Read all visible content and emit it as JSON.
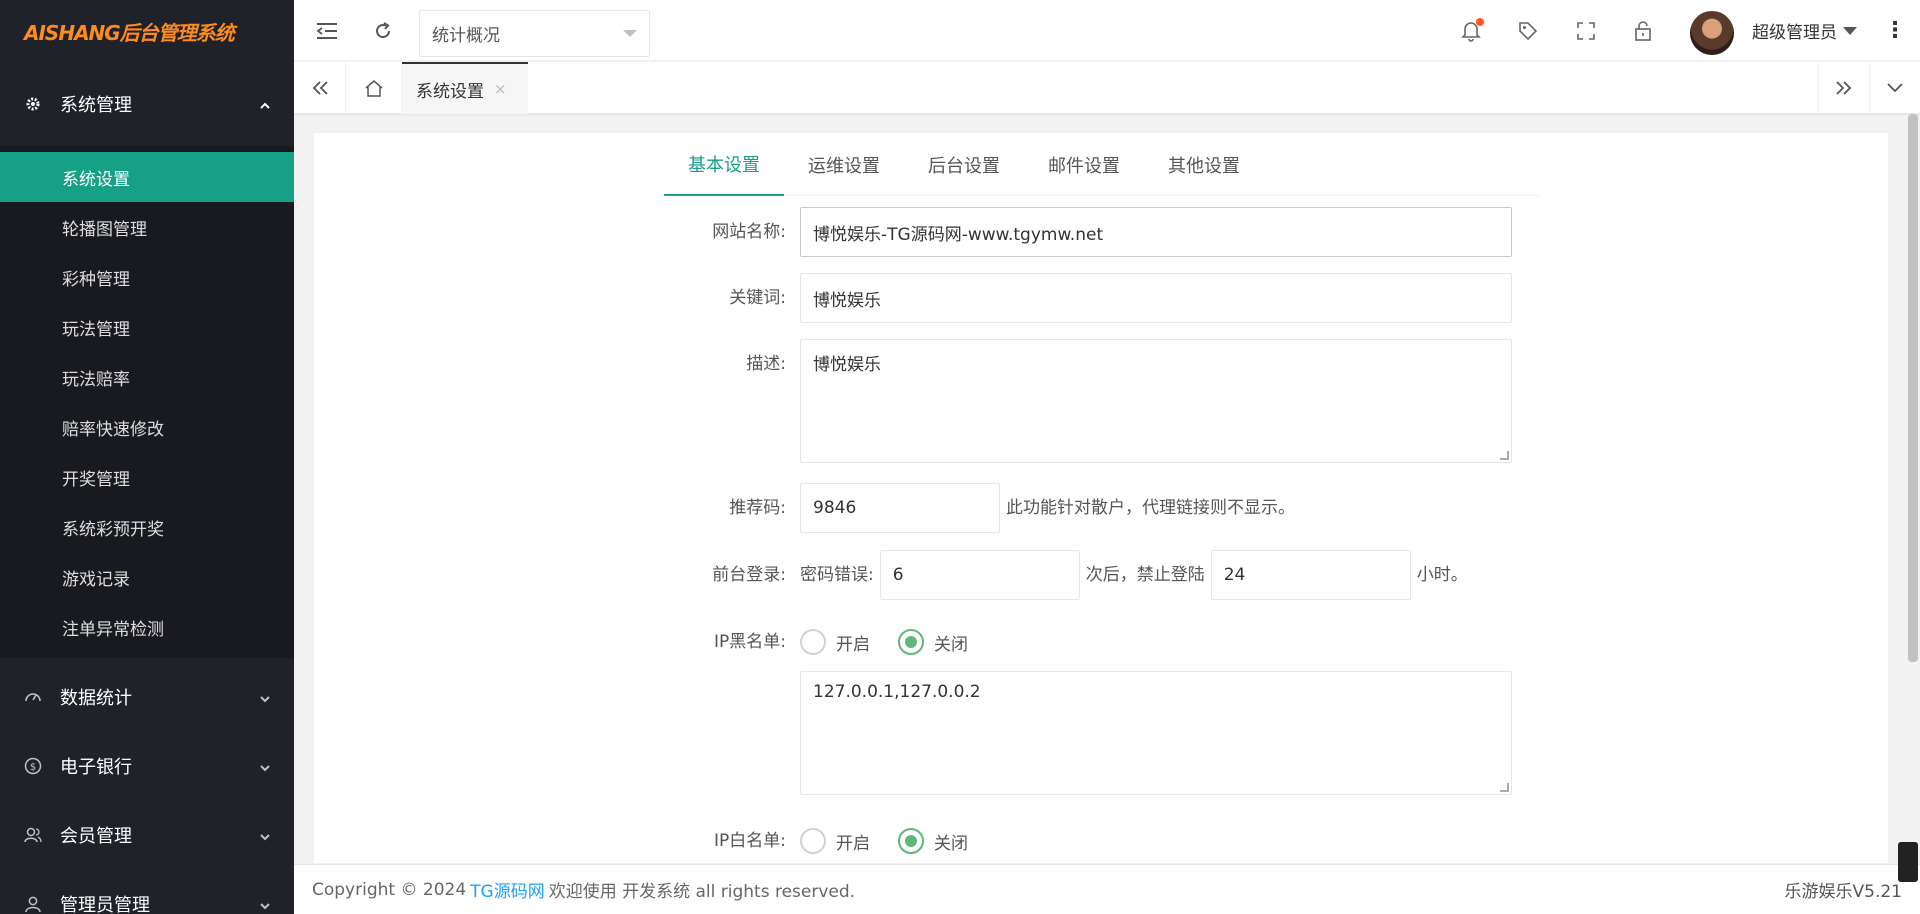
{
  "logo": "AISHANG后台管理系统",
  "sidebar": {
    "groups": [
      {
        "label": "系统管理",
        "icon": "gear-icon",
        "expanded": true
      },
      {
        "label": "数据统计",
        "icon": "dashboard-icon",
        "expanded": false
      },
      {
        "label": "电子银行",
        "icon": "dollar-icon",
        "expanded": false
      },
      {
        "label": "会员管理",
        "icon": "users-icon",
        "expanded": false
      },
      {
        "label": "管理员管理",
        "icon": "user-icon",
        "expanded": false
      }
    ],
    "system_items": [
      "系统设置",
      "轮播图管理",
      "彩种管理",
      "玩法管理",
      "玩法赔率",
      "赔率快速修改",
      "开奖管理",
      "系统彩预开奖",
      "游戏记录",
      "注单异常检测"
    ]
  },
  "header": {
    "select_value": "统计概况",
    "username": "超级管理员",
    "more": "⋮"
  },
  "tabsbar": {
    "active_tab": "系统设置",
    "close": "×"
  },
  "content": {
    "tabs": [
      "基本设置",
      "运维设置",
      "后台设置",
      "邮件设置",
      "其他设置"
    ],
    "site_name_label": "网站名称:",
    "site_name_value": "博悦娱乐-TG源码网-www.tgymw.net",
    "keywords_label": "关键词:",
    "keywords_value": "博悦娱乐",
    "desc_label": "描述:",
    "desc_value": "博悦娱乐",
    "ref_label": "推荐码:",
    "ref_value": "9846",
    "ref_note": "此功能针对散户，代理链接则不显示。",
    "login_label": "前台登录:",
    "login_pwd_label": "密码错误:",
    "login_pwd_value": "6",
    "login_mid": "次后，禁止登陆",
    "login_hours_value": "24",
    "login_hours_unit": "小时。",
    "ip_black_label": "IP黑名单:",
    "ip_black_value": "127.0.0.1,127.0.0.2",
    "ip_white_label": "IP白名单:",
    "radio_on": "开启",
    "radio_off": "关闭"
  },
  "footer": {
    "prefix": "Copyright © 2024",
    "link": "TG源码网",
    "suffix": "欢迎使用 开发系统 all rights reserved.",
    "version": "乐游娱乐V5.21"
  },
  "colors": {
    "sidebar_bg": "#20222a",
    "active_item": "#16a085",
    "radio_checked": "#5fb878",
    "link": "#1e9fff",
    "logo": "#ff8a1e"
  }
}
